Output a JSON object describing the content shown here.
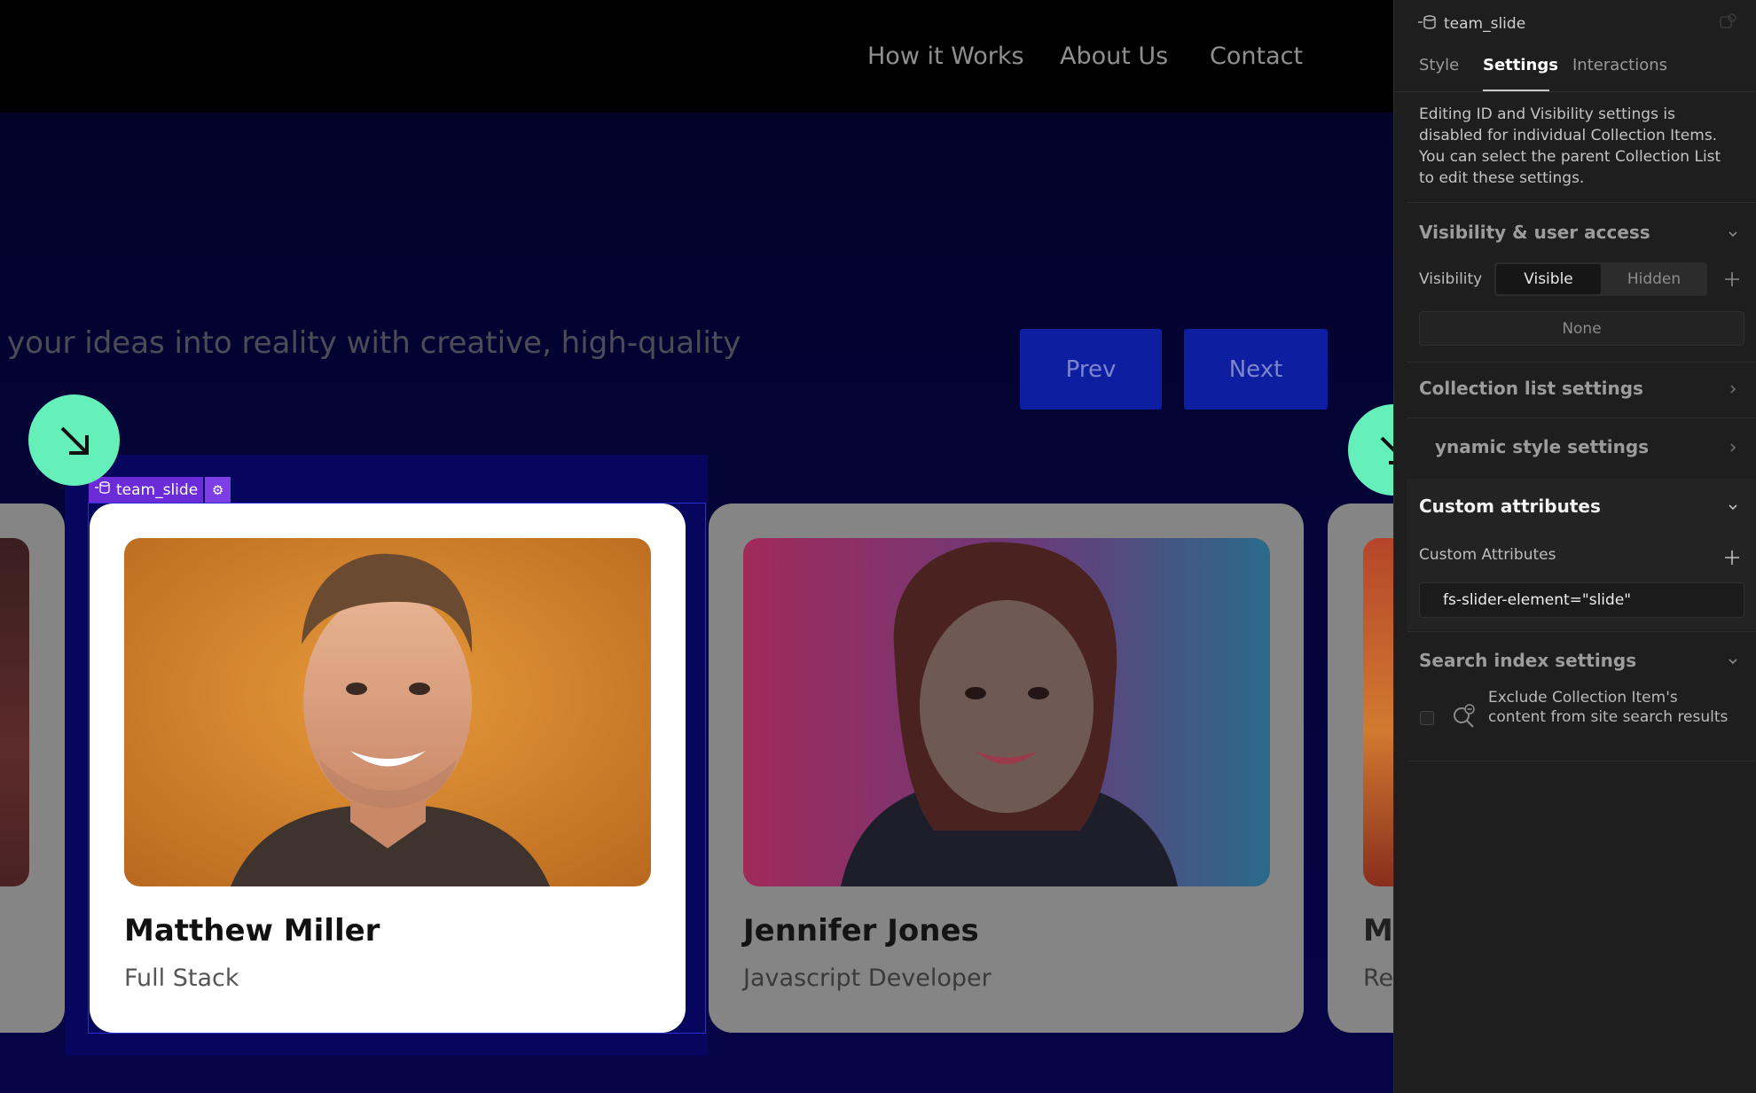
{
  "site": {
    "nav_links": [
      "How it Works",
      "About Us",
      "Contact"
    ],
    "hero_text": "your ideas into reality with creative, high-quality",
    "slider": {
      "prev_label": "Prev",
      "next_label": "Next"
    },
    "selected_element_tag": "team_slide",
    "cards": [
      {
        "name": "Matthew Miller",
        "role": "Full Stack"
      },
      {
        "name": "Jennifer Jones",
        "role": "Javascript Developer"
      },
      {
        "name": "Mc",
        "role": "Re"
      }
    ]
  },
  "panel": {
    "element_name": "team_slide",
    "tabs": [
      "Style",
      "Settings",
      "Interactions"
    ],
    "active_tab": "Settings",
    "notice": "Editing ID and Visibility settings is disabled for individual Collection Items. You can select the parent Collection List to edit these settings.",
    "sections": {
      "visibility": {
        "title": "Visibility & user access",
        "label": "Visibility",
        "options": [
          "Visible",
          "Hidden"
        ],
        "selected": "Visible",
        "access_value": "None"
      },
      "collection_list": {
        "title": "Collection list settings"
      },
      "dynamic_style": {
        "title": "ynamic style settings"
      },
      "custom_attributes": {
        "title": "Custom attributes",
        "label": "Custom Attributes",
        "attribute": "fs-slider-element=\"slide\""
      },
      "search_index": {
        "title": "Search index settings",
        "checkbox_label": "Exclude Collection Item's content from site search results"
      }
    }
  },
  "colors": {
    "accent_button": "#0e1ea0",
    "fab": "#66f0b9",
    "tag_purple": "#6b2bd9",
    "panel_bg": "#1e1e1e"
  }
}
